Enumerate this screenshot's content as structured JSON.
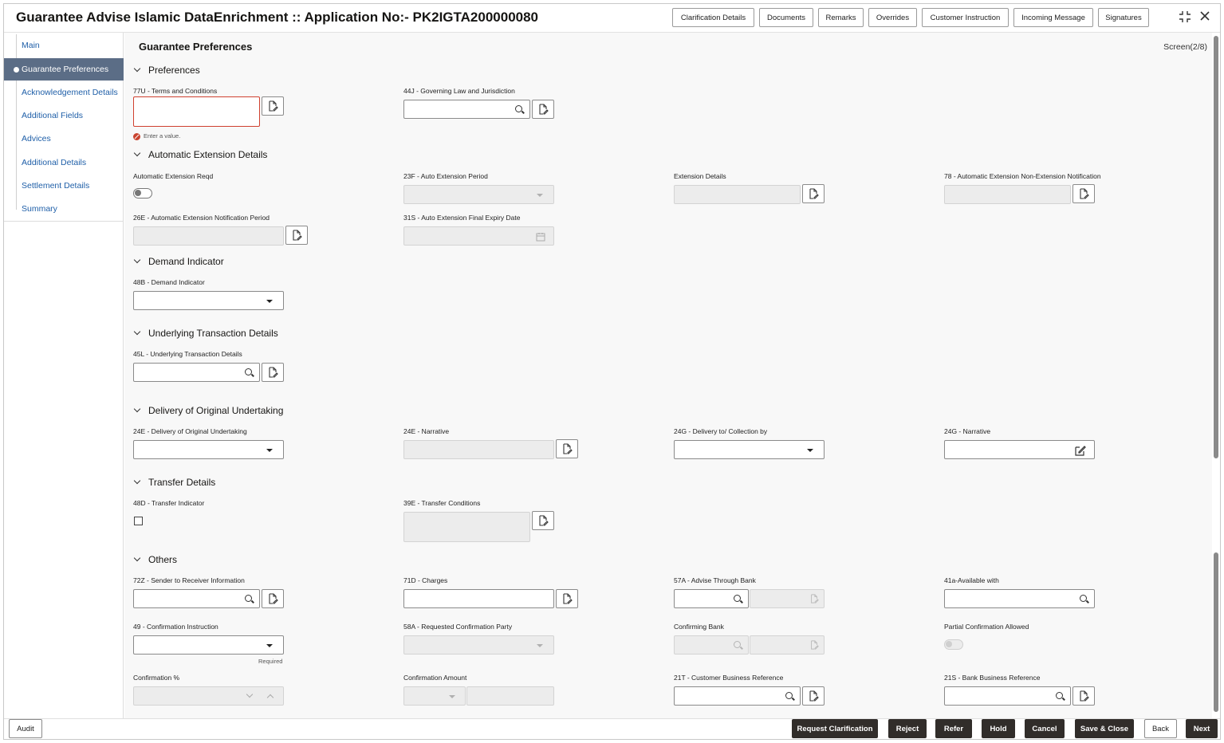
{
  "header": {
    "title": "Guarantee Advise Islamic DataEnrichment :: Application No:- PK2IGTA200000080",
    "buttons": [
      "Clarification Details",
      "Documents",
      "Remarks",
      "Overrides",
      "Customer Instruction",
      "Incoming Message",
      "Signatures"
    ]
  },
  "sidebar": {
    "items": [
      {
        "label": "Main"
      },
      {
        "label": "Guarantee Preferences"
      },
      {
        "label": "Acknowledgement Details"
      },
      {
        "label": "Additional Fields"
      },
      {
        "label": "Advices"
      },
      {
        "label": "Additional Details"
      },
      {
        "label": "Settlement Details"
      },
      {
        "label": "Summary"
      }
    ],
    "active_index": 1
  },
  "page": {
    "heading": "Guarantee Preferences",
    "screen_indicator": "Screen(2/8)"
  },
  "sections": {
    "preferences": "Preferences",
    "auto_ext": "Automatic Extension Details",
    "demand": "Demand Indicator",
    "underlying": "Underlying Transaction Details",
    "delivery": "Delivery of Original Undertaking",
    "transfer": "Transfer Details",
    "others": "Others"
  },
  "fields": {
    "f77u": "77U - Terms and Conditions",
    "f77u_error": "Enter a value.",
    "f44j": "44J - Governing Law and Jurisdiction",
    "auto_ext_reqd": "Automatic Extension Reqd",
    "f23f": "23F - Auto Extension Period",
    "ext_details": "Extension Details",
    "f78": "78 - Automatic Extension Non-Extension Notification",
    "f26e": "26E - Automatic Extension Notification Period",
    "f31s": "31S - Auto Extension Final Expiry Date",
    "f48b": "48B - Demand Indicator",
    "f45l": "45L - Underlying Transaction Details",
    "f24e": "24E - Delivery of Original Undertaking",
    "f24e_narr": "24E - Narrative",
    "f24g": "24G - Delivery to/ Collection by",
    "f24g_narr": "24G - Narrative",
    "f48d": "48D - Transfer Indicator",
    "f39e": "39E - Transfer Conditions",
    "f72z": "72Z - Sender to Receiver Information",
    "f71d": "71D - Charges",
    "f57a": "57A - Advise Through Bank",
    "f41a": "41a-Available with",
    "f49": "49 - Confirmation Instruction",
    "f49_hint": "Required",
    "f58a": "58A - Requested Confirmation Party",
    "conf_bank": "Confirming Bank",
    "partial_conf": "Partial Confirmation Allowed",
    "conf_pct": "Confirmation %",
    "conf_amt": "Confirmation Amount",
    "f21t": "21T - Customer Business Reference",
    "f21s": "21S - Bank Business Reference"
  },
  "footer": {
    "audit": "Audit",
    "actions": [
      "Request Clarification",
      "Reject",
      "Refer",
      "Hold",
      "Cancel",
      "Save & Close",
      "Back",
      "Next"
    ]
  },
  "icons": [
    "expand-icon",
    "close-icon",
    "chevron-down-icon",
    "search-icon",
    "edit-doc-icon",
    "calendar-icon",
    "error-icon"
  ]
}
